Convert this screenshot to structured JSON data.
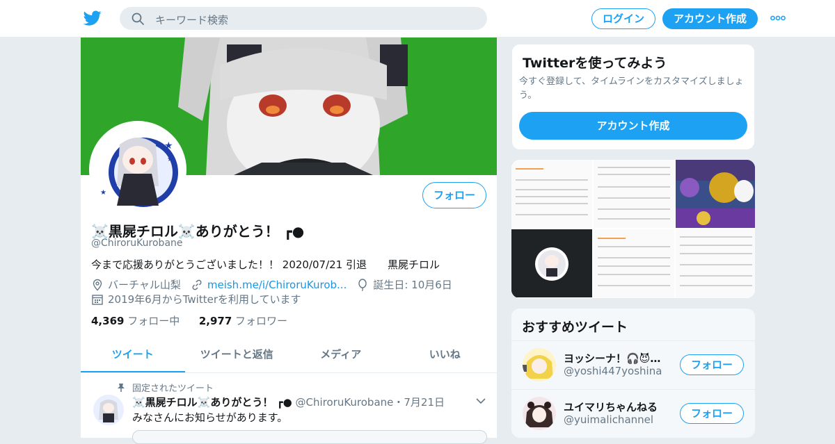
{
  "topbar": {
    "logo_icon": "twitter-bird-icon",
    "search_placeholder": "キーワード検索",
    "login_label": "ログイン",
    "signup_label": "アカウント作成",
    "more_icon": "more-dots-icon"
  },
  "profile": {
    "name": "☠️黒屍チロル☠️ありがとう！ ┏●",
    "handle": "@ChiroruKurobane",
    "follow_label": "フォロー",
    "bio": "今まで応援ありがとうございました！！ 2020/07/21 引退　　黒屍チロル",
    "location": "バーチャル山梨",
    "website": "meish.me/i/ChiroruKurob...",
    "birthday": "誕生日: 10月6日",
    "joined": "2019年6月からTwitterを利用しています",
    "following_count": "4,369",
    "following_label": "フォロー中",
    "followers_count": "2,977",
    "followers_label": "フォロワー"
  },
  "tabs": [
    {
      "label": "ツイート",
      "active": true
    },
    {
      "label": "ツイートと返信",
      "active": false
    },
    {
      "label": "メディア",
      "active": false
    },
    {
      "label": "いいね",
      "active": false
    }
  ],
  "pinned_tweet": {
    "pinned_label": "固定されたツイート",
    "author_name": "☠️黒屍チロル☠️ありがとう！ ┏●",
    "author_handle": "@ChiroruKurobane",
    "date": "・7月21日",
    "text": "みなさんにお知らせがあります。"
  },
  "signup_card": {
    "title": "Twitterを使ってみよう",
    "subtitle": "今すぐ登録して、タイムラインをカスタマイズしましょう。",
    "button_label": "アカウント作成"
  },
  "recommend": {
    "title": "おすすめツイート",
    "items": [
      {
        "name": "ヨッシーナ！🎧😈…",
        "handle": "@yoshi447yoshina",
        "button": "フォロー"
      },
      {
        "name": "ユイマリちゃんねる",
        "handle": "@yuimalichannel",
        "button": "フォロー"
      }
    ]
  },
  "colors": {
    "brand": "#1da1f2",
    "banner_green": "#2fa62a",
    "muted_text": "#657786"
  }
}
